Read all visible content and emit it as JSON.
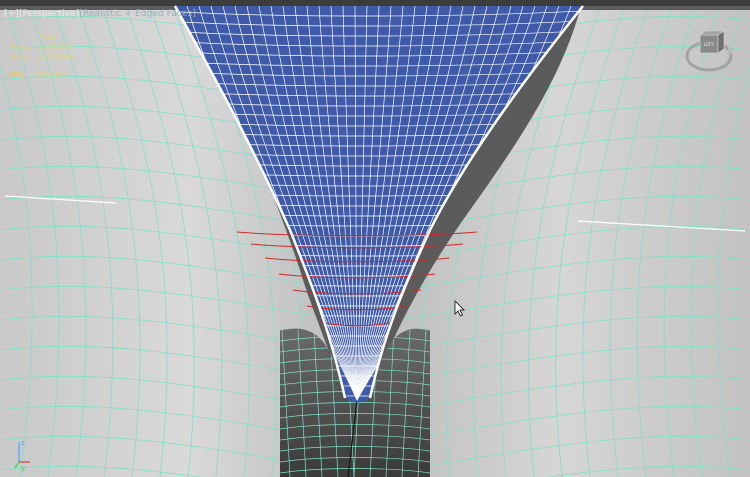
{
  "viewport": {
    "menu": "[+]",
    "view": "[Perspective]",
    "shading": "[Realistic + Edged Faces]"
  },
  "stats": {
    "header": "Total",
    "polys_label": "Polys:",
    "polys_value": "1,583,664",
    "verts_label": "Verts:",
    "verts_value": "1,571,298",
    "fps_label": "FPS:",
    "fps_value": "151.884"
  },
  "viewcube": {
    "label": "LEFT"
  },
  "axis": {
    "z": "z",
    "y": "y"
  },
  "colors": {
    "mesh_fill": "#d7d7d7",
    "wire_cyan": "#7fe0c8",
    "selected_fill": "#3e5aa8",
    "selected_wire": "#ffffff",
    "edge_loops": "#cc2a2a"
  }
}
